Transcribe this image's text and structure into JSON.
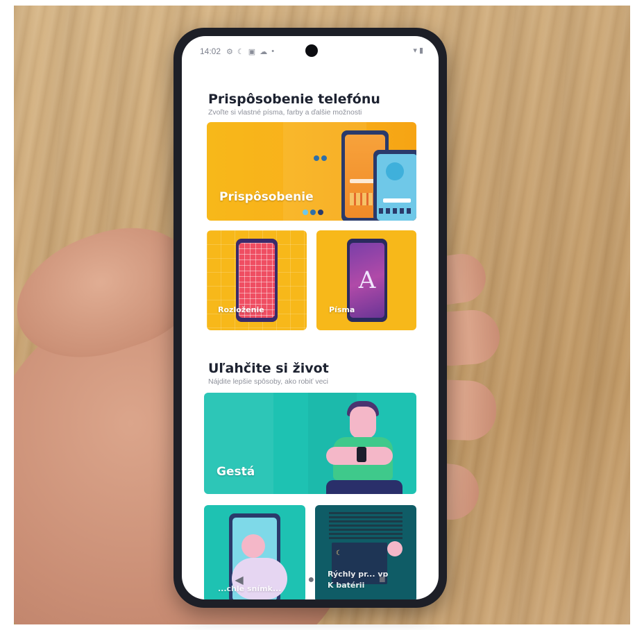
{
  "statusbar": {
    "time": "14:02",
    "icons": [
      "gear-icon",
      "moon-icon",
      "nfc-icon",
      "cloud-icon",
      "dot-icon"
    ],
    "right_icons": "wifi-icon battery-icon"
  },
  "section1": {
    "title": "Prispôsobenie telefónu",
    "subtitle": "Zvoľte si vlastné písma, farby a ďalšie možnosti"
  },
  "cards": {
    "customize_label": "Prispôsobenie",
    "layout_label": "Rozloženie",
    "fonts_label": "Písma",
    "fonts_glyph": "A",
    "gestures_label": "Gestá",
    "screenshot_label": "...chle snímk...",
    "quick_label_1": "Rýchly pr... vp",
    "quick_label_2": "K batérii"
  },
  "section2": {
    "title": "Uľahčite si život",
    "subtitle": "Nájdite lepšie spôsoby, ako robiť veci"
  },
  "navbar": {
    "back": "◀",
    "home": "●",
    "recents": "■"
  },
  "colors": {
    "yellow": "#f7b81a",
    "teal": "#1bbfb0",
    "phone_frame": "#1d1f27"
  }
}
